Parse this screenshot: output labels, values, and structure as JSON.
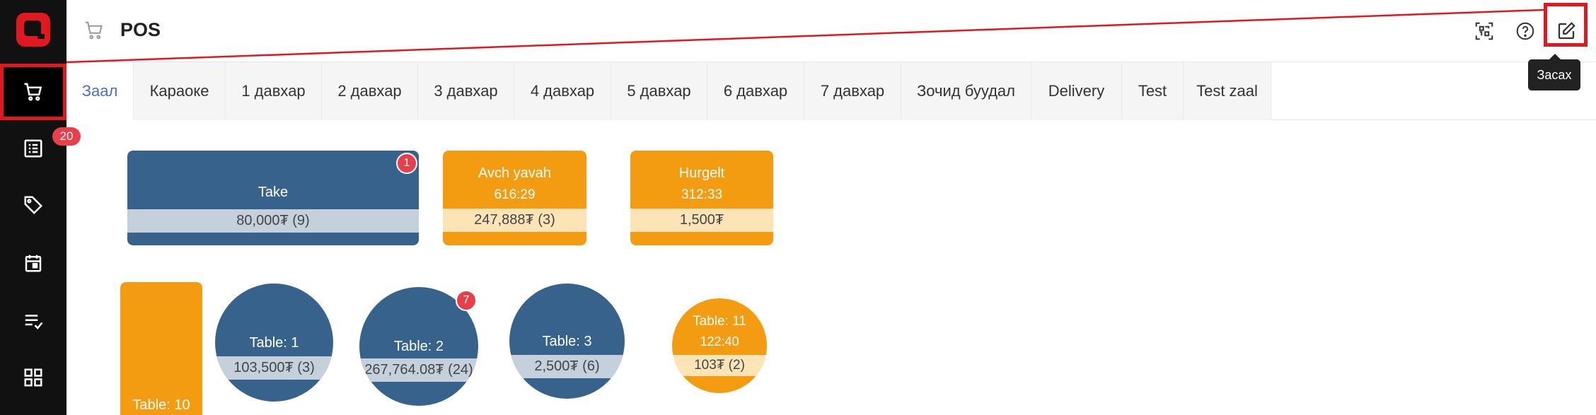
{
  "header": {
    "title": "POS",
    "edit_tooltip": "Засах"
  },
  "sidebar": {
    "orders_badge": "20"
  },
  "tabs": [
    "Заал",
    "Караоке",
    "1 давхар",
    "2 давхар",
    "3 давхар",
    "4 давхар",
    "5 давхар",
    "6 давхар",
    "7 давхар",
    "Зочид буудал",
    "Delivery",
    "Test",
    "Test zaal"
  ],
  "tables": {
    "take": {
      "name": "Take",
      "amount": "80,000₮ (9)",
      "badge": "1"
    },
    "avch": {
      "name": "Avch yavah",
      "time": "616:29",
      "amount": "247,888₮ (3)"
    },
    "hurgelt": {
      "name": "Hurgelt",
      "time": "312:33",
      "amount": "1,500₮"
    },
    "t10": {
      "name": "Table: 10"
    },
    "t1": {
      "name": "Table: 1",
      "amount": "103,500₮ (3)"
    },
    "t2": {
      "name": "Table: 2",
      "amount": "267,764.08₮ (24)",
      "badge": "7"
    },
    "t3": {
      "name": "Table: 3",
      "amount": "2,500₮ (6)"
    },
    "t11": {
      "name": "Table: 11",
      "time": "122:40",
      "amount": "103₮ (2)"
    }
  },
  "colors": {
    "blue": "#37628c",
    "orange": "#f39c12",
    "accent": "#4a6fc9",
    "highlight": "#e0181f"
  }
}
